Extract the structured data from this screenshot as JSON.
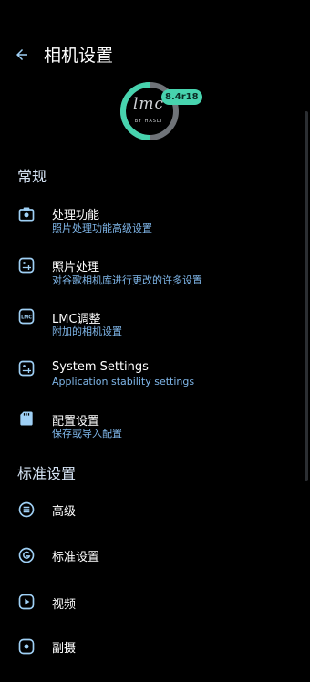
{
  "header": {
    "title": "相机设置",
    "back_icon": "back-arrow-icon"
  },
  "logo": {
    "mark": "lmc",
    "byline": "BY HASLI",
    "version": "8.4r18"
  },
  "sections": [
    {
      "title": "常规",
      "items": [
        {
          "icon": "camera-icon",
          "title": "处理功能",
          "subtitle": "照片处理功能高级设置"
        },
        {
          "icon": "image-settings-icon",
          "title": "照片处理",
          "subtitle": "对谷歌相机库进行更改的许多设置"
        },
        {
          "icon": "lmc-badge-icon",
          "title": "LMC调整",
          "subtitle": "附加的相机设置"
        },
        {
          "icon": "image-settings-icon",
          "title": "System Settings",
          "subtitle": "Application stability settings"
        },
        {
          "icon": "sd-card-icon",
          "title": "配置设置",
          "subtitle": "保存或导入配置"
        }
      ]
    },
    {
      "title": "标准设置",
      "items": [
        {
          "icon": "list-icon",
          "title": "高级"
        },
        {
          "icon": "google-icon",
          "title": "标准设置"
        },
        {
          "icon": "video-play-icon",
          "title": "视频"
        },
        {
          "icon": "secondary-camera-icon",
          "title": "副摄"
        }
      ]
    }
  ],
  "colors": {
    "background": "#000000",
    "accent": "#47d3ae",
    "subtitle": "#7fb6e9",
    "icon": "#9fd0f5"
  }
}
